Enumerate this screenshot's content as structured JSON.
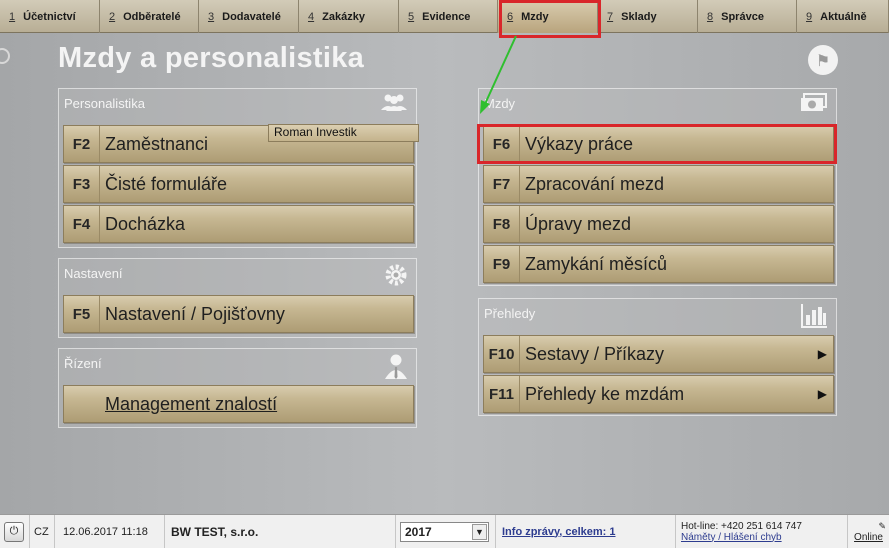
{
  "menu": {
    "tabs": [
      {
        "num": "1",
        "label": "Účetnictví"
      },
      {
        "num": "2",
        "label": "Odběratelé"
      },
      {
        "num": "3",
        "label": "Dodavatelé"
      },
      {
        "num": "4",
        "label": "Zakázky"
      },
      {
        "num": "5",
        "label": "Evidence"
      },
      {
        "num": "6",
        "label": "Mzdy"
      },
      {
        "num": "7",
        "label": "Sklady"
      },
      {
        "num": "8",
        "label": "Správce"
      },
      {
        "num": "9",
        "label": "Aktuálně"
      }
    ],
    "active": "Mzdy"
  },
  "page_title": "Mzdy a personalistika",
  "panels": {
    "personalistika": {
      "title": "Personalistika",
      "icon": "people-icon",
      "items": [
        {
          "key": "F2",
          "label": "Zaměstnanci"
        },
        {
          "key": "F3",
          "label": "Čisté formuláře"
        },
        {
          "key": "F4",
          "label": "Docházka"
        }
      ]
    },
    "nastaveni": {
      "title": "Nastavení",
      "icon": "gear-icon",
      "items": [
        {
          "key": "F5",
          "label": "Nastavení / Pojišťovny"
        }
      ]
    },
    "rizeni": {
      "title": "Řízení",
      "icon": "manager-icon",
      "items": [
        {
          "key": "",
          "label": "Management znalostí"
        }
      ]
    },
    "mzdy": {
      "title": "Mzdy",
      "icon": "money-icon",
      "items": [
        {
          "key": "F6",
          "label": "Výkazy práce"
        },
        {
          "key": "F7",
          "label": "Zpracování mezd"
        },
        {
          "key": "F8",
          "label": "Úpravy mezd"
        },
        {
          "key": "F9",
          "label": "Zamykání měsíců"
        }
      ]
    },
    "prehledy": {
      "title": "Přehledy",
      "icon": "bar-chart-icon",
      "items": [
        {
          "key": "F10",
          "label": "Sestavy / Příkazy"
        },
        {
          "key": "F11",
          "label": "Přehledy ke mzdám"
        }
      ]
    }
  },
  "tooltip": "Roman Investik",
  "status": {
    "lang": "CZ",
    "datetime": "12.06.2017  11:18",
    "company": "BW TEST, s.r.o.",
    "year": "2017",
    "info": "Info zprávy, celkem: 1",
    "hotline": "Hot-line: +420 251 614 747",
    "feedback": "Náměty / Hlášení chyb",
    "online": "Online"
  },
  "colors": {
    "highlight": "#d9262a",
    "arrow": "#2fbf2f"
  }
}
